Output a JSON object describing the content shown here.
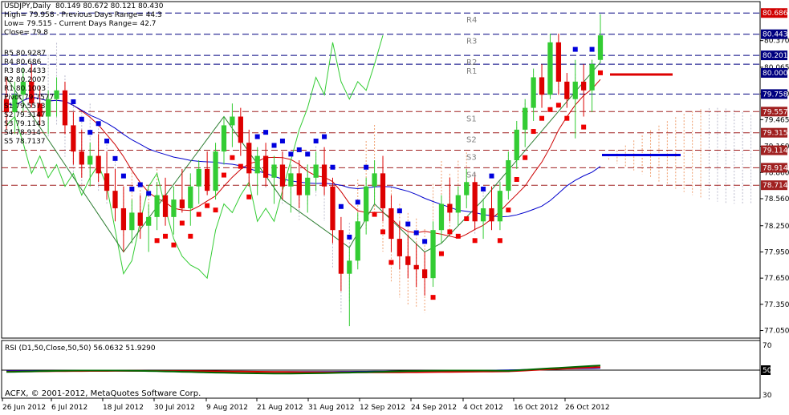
{
  "header": {
    "line1": "USDJPY,Daily  80.149 80.672 80.121 80.430",
    "line2": "High= 79.958 - Previous Days Range= 44.3",
    "line3": "Low= 79.515 - Current Days Range= 42.7",
    "line4": "Close= 79.8"
  },
  "pivot_labels": [
    "R5 80.9287",
    "R4 80.686",
    "R3 80.4433",
    "R2 80.2007",
    "R1 80.1003",
    "Pivot 79.7577",
    "S1 79.5573",
    "S2 79.3147",
    "S3 79.1143",
    "S4 78.914",
    "S5 78.7137"
  ],
  "level_tags": [
    "R4",
    "R3",
    "R2",
    "R1",
    "S1",
    "S2",
    "S3",
    "S4"
  ],
  "price_axis": {
    "ticks": [
      "80.370",
      "80.065",
      "79.760",
      "79.465",
      "79.160",
      "78.860",
      "78.560",
      "78.250",
      "77.950",
      "77.650",
      "77.350",
      "77.050"
    ],
    "tick_values": [
      80.37,
      80.065,
      79.76,
      79.465,
      79.16,
      78.86,
      78.56,
      78.25,
      77.95,
      77.65,
      77.35,
      77.05
    ],
    "min": 77.0,
    "max": 80.78
  },
  "price_boxes": [
    {
      "text": "80.686",
      "value": 80.686,
      "color": "#d00000",
      "text_color": "#ffffff"
    },
    {
      "text": "80.443",
      "value": 80.443,
      "color": "#000080",
      "text_color": "#ffffff"
    },
    {
      "text": "80.201",
      "value": 80.201,
      "color": "#000080",
      "text_color": "#ffffff"
    },
    {
      "text": "80.000",
      "value": 80.0,
      "color": "#000080",
      "text_color": "#ffffff"
    },
    {
      "text": "79.758",
      "value": 79.758,
      "color": "#000080",
      "text_color": "#ffffff"
    },
    {
      "text": "79.557",
      "value": 79.557,
      "color": "#a02020",
      "text_color": "#ffffff"
    },
    {
      "text": "79.315",
      "value": 79.315,
      "color": "#a02020",
      "text_color": "#ffffff"
    },
    {
      "text": "79.114",
      "value": 79.114,
      "color": "#a02020",
      "text_color": "#ffffff"
    },
    {
      "text": "78.914",
      "value": 78.914,
      "color": "#a02020",
      "text_color": "#ffffff"
    },
    {
      "text": "78.714",
      "value": 78.714,
      "color": "#a02020",
      "text_color": "#ffffff"
    }
  ],
  "date_axis": [
    "26 Jun 2012",
    "6 Jul 2012",
    "18 Jul 2012",
    "30 Jul 2012",
    "9 Aug 2012",
    "21 Aug 2012",
    "31 Aug 2012",
    "12 Sep 2012",
    "24 Sep 2012",
    "4 Oct 2012",
    "16 Oct 2012",
    "26 Oct 2012"
  ],
  "rsi_panel": {
    "label": "RSI (D1,50,Close,50,50) 56.0632 51.9290",
    "ticks": [
      "70",
      "50",
      "30"
    ],
    "tick_values": [
      70,
      50,
      30
    ]
  },
  "copyright": "ACFX, © 2001-2012, MetaQuotes Software Corp.",
  "colors": {
    "bull": "#33cc33",
    "bear": "#dd0000",
    "resistance": "#000080",
    "support": "#a02020",
    "kumo_bull": "#bbbbcc",
    "kumo_bear": "#f0a070",
    "tenkan": "#cc0000",
    "kijun": "#0000cc",
    "chikou": "#33cc33",
    "zigzag": "#2e7d32"
  },
  "chart_data": {
    "type": "candlestick",
    "symbol": "USDJPY",
    "timeframe": "Daily",
    "ylim": [
      77.0,
      80.78
    ],
    "candles": [
      {
        "o": 79.7,
        "h": 79.95,
        "l": 79.35,
        "c": 79.55
      },
      {
        "o": 79.55,
        "h": 79.9,
        "l": 79.3,
        "c": 79.75
      },
      {
        "o": 79.75,
        "h": 80.05,
        "l": 79.55,
        "c": 79.9
      },
      {
        "o": 79.9,
        "h": 80.1,
        "l": 79.6,
        "c": 79.65
      },
      {
        "o": 79.65,
        "h": 79.85,
        "l": 79.4,
        "c": 79.5
      },
      {
        "o": 79.5,
        "h": 79.8,
        "l": 79.3,
        "c": 79.7
      },
      {
        "o": 79.7,
        "h": 79.95,
        "l": 79.5,
        "c": 79.8
      },
      {
        "o": 79.8,
        "h": 79.9,
        "l": 79.3,
        "c": 79.4
      },
      {
        "o": 79.4,
        "h": 79.55,
        "l": 78.95,
        "c": 79.1
      },
      {
        "o": 79.1,
        "h": 79.35,
        "l": 78.8,
        "c": 78.95
      },
      {
        "o": 78.95,
        "h": 79.2,
        "l": 78.7,
        "c": 79.05
      },
      {
        "o": 79.05,
        "h": 79.3,
        "l": 78.75,
        "c": 78.85
      },
      {
        "o": 78.85,
        "h": 79.1,
        "l": 78.55,
        "c": 78.65
      },
      {
        "o": 78.65,
        "h": 78.9,
        "l": 78.3,
        "c": 78.45
      },
      {
        "o": 78.45,
        "h": 78.7,
        "l": 77.95,
        "c": 78.2
      },
      {
        "o": 78.2,
        "h": 78.55,
        "l": 78.05,
        "c": 78.4
      },
      {
        "o": 78.4,
        "h": 78.6,
        "l": 78.1,
        "c": 78.25
      },
      {
        "o": 78.25,
        "h": 78.5,
        "l": 77.95,
        "c": 78.35
      },
      {
        "o": 78.35,
        "h": 78.75,
        "l": 78.2,
        "c": 78.6
      },
      {
        "o": 78.6,
        "h": 78.8,
        "l": 78.25,
        "c": 78.35
      },
      {
        "o": 78.35,
        "h": 78.7,
        "l": 78.15,
        "c": 78.55
      },
      {
        "o": 78.55,
        "h": 78.9,
        "l": 78.4,
        "c": 78.45
      },
      {
        "o": 78.45,
        "h": 78.85,
        "l": 78.25,
        "c": 78.7
      },
      {
        "o": 78.7,
        "h": 79.0,
        "l": 78.5,
        "c": 78.9
      },
      {
        "o": 78.9,
        "h": 79.1,
        "l": 78.6,
        "c": 78.65
      },
      {
        "o": 78.65,
        "h": 79.2,
        "l": 78.55,
        "c": 79.1
      },
      {
        "o": 79.1,
        "h": 79.5,
        "l": 78.95,
        "c": 79.4
      },
      {
        "o": 79.4,
        "h": 79.65,
        "l": 79.15,
        "c": 79.5
      },
      {
        "o": 79.5,
        "h": 79.6,
        "l": 79.05,
        "c": 79.2
      },
      {
        "o": 79.2,
        "h": 79.35,
        "l": 78.7,
        "c": 78.85
      },
      {
        "o": 78.85,
        "h": 79.15,
        "l": 78.6,
        "c": 79.05
      },
      {
        "o": 79.05,
        "h": 79.2,
        "l": 78.7,
        "c": 78.8
      },
      {
        "o": 78.8,
        "h": 79.05,
        "l": 78.5,
        "c": 78.95
      },
      {
        "o": 78.95,
        "h": 79.1,
        "l": 78.55,
        "c": 78.7
      },
      {
        "o": 78.7,
        "h": 78.95,
        "l": 78.4,
        "c": 78.85
      },
      {
        "o": 78.85,
        "h": 79.0,
        "l": 78.45,
        "c": 78.6
      },
      {
        "o": 78.6,
        "h": 78.95,
        "l": 78.4,
        "c": 78.8
      },
      {
        "o": 78.8,
        "h": 79.1,
        "l": 78.65,
        "c": 78.95
      },
      {
        "o": 78.95,
        "h": 79.15,
        "l": 78.6,
        "c": 78.7
      },
      {
        "o": 78.7,
        "h": 78.8,
        "l": 78.05,
        "c": 78.2
      },
      {
        "o": 78.2,
        "h": 78.35,
        "l": 77.5,
        "c": 77.7
      },
      {
        "o": 77.7,
        "h": 78.0,
        "l": 77.1,
        "c": 77.85
      },
      {
        "o": 77.85,
        "h": 78.4,
        "l": 77.75,
        "c": 78.3
      },
      {
        "o": 78.3,
        "h": 78.8,
        "l": 78.15,
        "c": 78.7
      },
      {
        "o": 78.7,
        "h": 79.0,
        "l": 78.5,
        "c": 78.85
      },
      {
        "o": 78.85,
        "h": 79.05,
        "l": 78.3,
        "c": 78.45
      },
      {
        "o": 78.45,
        "h": 78.6,
        "l": 77.95,
        "c": 78.1
      },
      {
        "o": 78.1,
        "h": 78.3,
        "l": 77.75,
        "c": 77.9
      },
      {
        "o": 77.9,
        "h": 78.15,
        "l": 77.65,
        "c": 77.8
      },
      {
        "o": 77.8,
        "h": 78.05,
        "l": 77.55,
        "c": 77.75
      },
      {
        "o": 77.75,
        "h": 77.95,
        "l": 77.45,
        "c": 77.65
      },
      {
        "o": 77.65,
        "h": 78.3,
        "l": 77.55,
        "c": 78.2
      },
      {
        "o": 78.2,
        "h": 78.6,
        "l": 78.05,
        "c": 78.5
      },
      {
        "o": 78.5,
        "h": 78.8,
        "l": 78.3,
        "c": 78.4
      },
      {
        "o": 78.4,
        "h": 78.7,
        "l": 78.25,
        "c": 78.6
      },
      {
        "o": 78.6,
        "h": 78.9,
        "l": 78.45,
        "c": 78.75
      },
      {
        "o": 78.75,
        "h": 78.85,
        "l": 78.2,
        "c": 78.3
      },
      {
        "o": 78.3,
        "h": 78.55,
        "l": 78.1,
        "c": 78.45
      },
      {
        "o": 78.45,
        "h": 78.7,
        "l": 78.2,
        "c": 78.3
      },
      {
        "o": 78.3,
        "h": 78.75,
        "l": 78.2,
        "c": 78.65
      },
      {
        "o": 78.65,
        "h": 79.1,
        "l": 78.55,
        "c": 79.0
      },
      {
        "o": 79.0,
        "h": 79.45,
        "l": 78.9,
        "c": 79.35
      },
      {
        "o": 79.35,
        "h": 79.7,
        "l": 79.15,
        "c": 79.6
      },
      {
        "o": 79.6,
        "h": 80.05,
        "l": 79.45,
        "c": 79.95
      },
      {
        "o": 79.95,
        "h": 80.1,
        "l": 79.6,
        "c": 79.75
      },
      {
        "o": 79.75,
        "h": 80.45,
        "l": 79.7,
        "c": 80.35
      },
      {
        "o": 80.35,
        "h": 80.45,
        "l": 79.75,
        "c": 79.9
      },
      {
        "o": 79.9,
        "h": 80.0,
        "l": 79.6,
        "c": 79.7
      },
      {
        "o": 79.7,
        "h": 80.15,
        "l": 79.25,
        "c": 79.9
      },
      {
        "o": 79.9,
        "h": 80.1,
        "l": 79.5,
        "c": 79.8
      },
      {
        "o": 79.8,
        "h": 80.15,
        "l": 79.55,
        "c": 80.1
      },
      {
        "o": 80.149,
        "h": 80.672,
        "l": 80.121,
        "c": 80.43
      }
    ],
    "levels": [
      {
        "name": "R5",
        "value": 80.9287
      },
      {
        "name": "R4",
        "value": 80.686
      },
      {
        "name": "R3",
        "value": 80.4433
      },
      {
        "name": "R2",
        "value": 80.2007
      },
      {
        "name": "R1",
        "value": 80.1003
      },
      {
        "name": "Pivot",
        "value": 79.7577
      },
      {
        "name": "S1",
        "value": 79.5573
      },
      {
        "name": "S2",
        "value": 79.3147
      },
      {
        "name": "S3",
        "value": 79.1143
      },
      {
        "name": "S4",
        "value": 78.914
      },
      {
        "name": "S5",
        "value": 78.7137
      }
    ],
    "indicators": {
      "rsi": {
        "period": 50,
        "value_1": 56.0632,
        "value_2": 51.929,
        "range": [
          30,
          70
        ]
      }
    },
    "grid": false
  }
}
